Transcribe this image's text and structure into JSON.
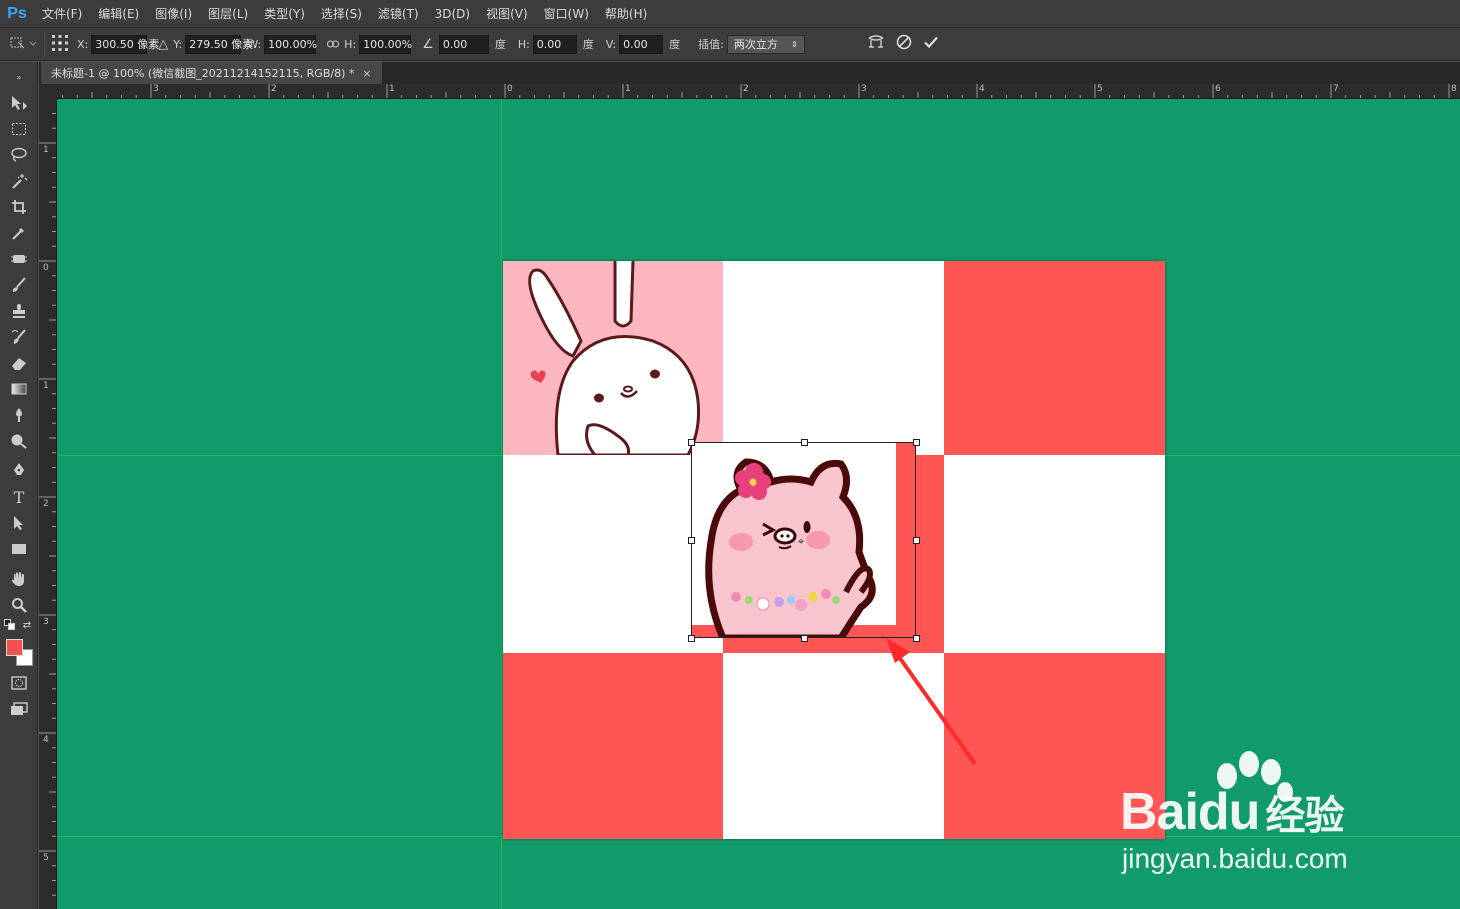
{
  "app": {
    "logo": "Ps"
  },
  "menu": [
    {
      "label": "文件(F)"
    },
    {
      "label": "编辑(E)"
    },
    {
      "label": "图像(I)"
    },
    {
      "label": "图层(L)"
    },
    {
      "label": "类型(Y)"
    },
    {
      "label": "选择(S)"
    },
    {
      "label": "滤镜(T)"
    },
    {
      "label": "3D(D)"
    },
    {
      "label": "视图(V)"
    },
    {
      "label": "窗口(W)"
    },
    {
      "label": "帮助(H)"
    }
  ],
  "options": {
    "x_label": "X:",
    "x_value": "300.50 像素",
    "y_label": "Y:",
    "y_value": "279.50 像素",
    "w_label": "W:",
    "w_value": "100.00%",
    "h_label": "H:",
    "h_value": "100.00%",
    "rotate_value": "0.00",
    "rotate_unit": "度",
    "hskew_label": "H:",
    "hskew_value": "0.00",
    "hskew_unit": "度",
    "vskew_label": "V:",
    "vskew_value": "0.00",
    "vskew_unit": "度",
    "interp_label": "插值:",
    "interp_value": "两次立方"
  },
  "document_tab": {
    "title": "未标题-1 @ 100% (微信截图_20211214152115, RGB/8) *",
    "close": "×"
  },
  "ruler_top_labels": [
    "3",
    "2",
    "1",
    "0",
    "1",
    "2",
    "3",
    "4",
    "5",
    "6",
    "7",
    "8"
  ],
  "ruler_left_labels": [
    "1",
    "0",
    "1",
    "2",
    "3",
    "4",
    "5"
  ],
  "colors": {
    "canvas_bg": "#119b6a",
    "checker_red": "#ff5555",
    "checker_white": "#ffffff",
    "rabbit_bg": "#fbb6c0",
    "foreground": "#f05050",
    "background": "#ffffff",
    "arrow": "#ff2a2a"
  },
  "watermark": {
    "brand": "Bai",
    "brand2": "du",
    "cn": "经验",
    "url": "jingyan.baidu.com"
  }
}
